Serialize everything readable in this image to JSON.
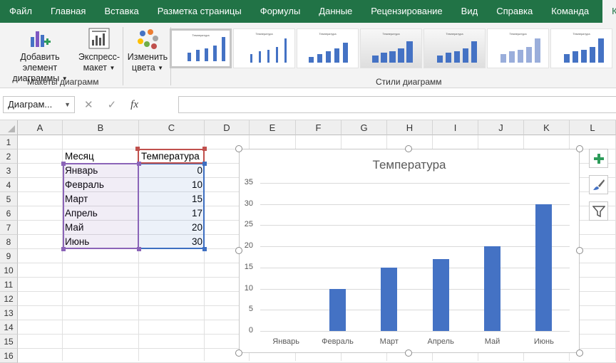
{
  "ribbon": {
    "tabs": [
      "Файл",
      "Главная",
      "Вставка",
      "Разметка страницы",
      "Формулы",
      "Данные",
      "Рецензирование",
      "Вид",
      "Справка",
      "Команда",
      "Конструк"
    ],
    "active_tab": "Конструк",
    "buttons": {
      "add_element": [
        "Добавить элемент",
        "диаграммы"
      ],
      "express_layout": [
        "Экспресс-",
        "макет"
      ],
      "change_colors": [
        "Изменить",
        "цвета"
      ]
    },
    "groups": {
      "layouts": "Макеты диаграмм",
      "styles": "Стили диаграмм"
    },
    "style_thumb_title": "Температура"
  },
  "formula_bar": {
    "name_box": "Диаграм...",
    "formula": "",
    "cancel_icon": "x-icon",
    "enter_icon": "check-icon",
    "fx_label": "fx"
  },
  "sheet": {
    "columns": [
      "A",
      "B",
      "C",
      "D",
      "E",
      "F",
      "G",
      "H",
      "I",
      "J",
      "K",
      "L"
    ],
    "rows": [
      "1",
      "2",
      "3",
      "4",
      "5",
      "6",
      "7",
      "8",
      "9",
      "10",
      "11",
      "12",
      "13",
      "14",
      "15",
      "16"
    ],
    "header_month": "Месяц",
    "header_temp": "Температура",
    "data": [
      {
        "month": "Январь",
        "temp": "0"
      },
      {
        "month": "Февраль",
        "temp": "10"
      },
      {
        "month": "Март",
        "temp": "15"
      },
      {
        "month": "Апрель",
        "temp": "17"
      },
      {
        "month": "Май",
        "temp": "20"
      },
      {
        "month": "Июнь",
        "temp": "30"
      }
    ]
  },
  "colors": {
    "accent": "#217346",
    "bar": "#4472c4",
    "range_month": "#8b64b8",
    "range_temp": "#3e6fc1",
    "range_header": "#c0504d"
  },
  "chart_data": {
    "type": "bar",
    "title": "Температура",
    "categories": [
      "Январь",
      "Февраль",
      "Март",
      "Апрель",
      "Май",
      "Июнь"
    ],
    "values": [
      0,
      10,
      15,
      17,
      20,
      30
    ],
    "yticks": [
      "0",
      "5",
      "10",
      "15",
      "20",
      "25",
      "30",
      "35"
    ],
    "ylim": [
      0,
      35
    ],
    "grid": true,
    "legend": "none"
  },
  "chart_side_buttons": [
    "plus-icon",
    "brush-icon",
    "filter-icon"
  ]
}
